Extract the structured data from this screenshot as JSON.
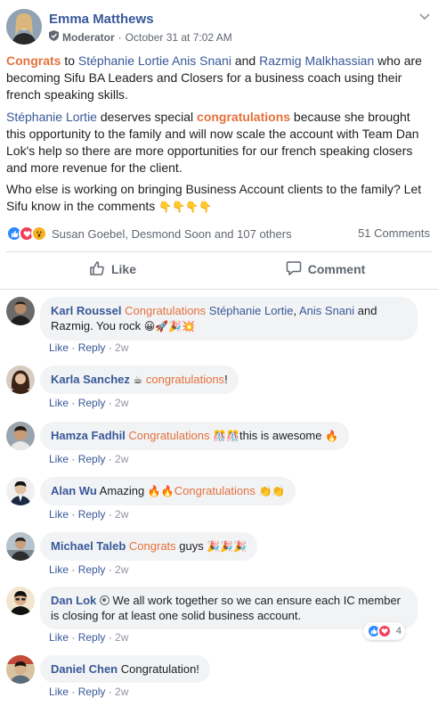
{
  "post": {
    "author": "Emma Matthews",
    "role": "Moderator",
    "dot": "·",
    "timestamp": "October 31 at 7:02 AM",
    "p1_hl1": "Congrats",
    "p1_t1": " to ",
    "p1_lk1": "Stéphanie Lortie",
    "p1_t2": " ",
    "p1_lk2": "Anis Snani",
    "p1_t3": " and ",
    "p1_lk3": "Razmig Malkhassian",
    "p1_t4": " who are becoming Sifu BA Leaders and Closers for a business coach using their french speaking skills.",
    "p2_lk1": "Stéphanie Lortie",
    "p2_t1": " deserves special ",
    "p2_hl1": "congratulations",
    "p2_t2": " because she brought this opportunity to the family and will now scale the account with Team Dan Lok's help so there are more opportunities for our french speaking closers and more revenue for the client.",
    "p3": "Who else is working on bringing Business Account clients to the family? Let Sifu know in the comments",
    "p3_emoji": "👇👇👇👇",
    "reactions_summary": "Susan Goebel, Desmond Soon and 107 others",
    "comments_count": "51 Comments",
    "like_label": "Like",
    "comment_label": "Comment"
  },
  "comments": [
    {
      "name": "Karl Roussel",
      "org": "Congratulations",
      "t1": " ",
      "lk1": "Stéphanie Lortie",
      "t2": ", ",
      "lk2": "Anis Snani",
      "t3": " and Razmig. You rock ",
      "emoji": "😀🚀🎉💥",
      "like": "Like",
      "reply": "Reply",
      "time": "2w"
    },
    {
      "name": "Karla Sanchez",
      "pre_emoji": "☕",
      "org": "congratulations",
      "t1": "!",
      "like": "Like",
      "reply": "Reply",
      "time": "2w"
    },
    {
      "name": "Hamza Fadhil",
      "org": "Congratulations",
      "emoji": "🎊🎊",
      "t1": "this is awesome ",
      "emoji2": "🔥",
      "like": "Like",
      "reply": "Reply",
      "time": "2w"
    },
    {
      "name": "Alan Wu",
      "t1": "Amazing ",
      "emoji": "🔥🔥",
      "org": "Congratulations",
      "emoji2": "👏👏",
      "like": "Like",
      "reply": "Reply",
      "time": "2w"
    },
    {
      "name": "Michael Taleb",
      "org": "Congrats",
      "t1": " guys ",
      "emoji": "🎉🎉🎉",
      "like": "Like",
      "reply": "Reply",
      "time": "2w"
    },
    {
      "name": "Dan Lok",
      "t1": "We all work together so we can ensure each IC member is closing for at least one solid business account.",
      "react_count": "4",
      "like": "Like",
      "reply": "Reply",
      "time": "2w"
    },
    {
      "name": "Daniel Chen",
      "t1": "Congratulation!",
      "like": "Like",
      "reply": "Reply",
      "time": "2w"
    }
  ],
  "colors": {
    "link": "#385898",
    "highlight": "#e4713c",
    "muted": "#606770",
    "bubble": "#f2f3f5"
  }
}
